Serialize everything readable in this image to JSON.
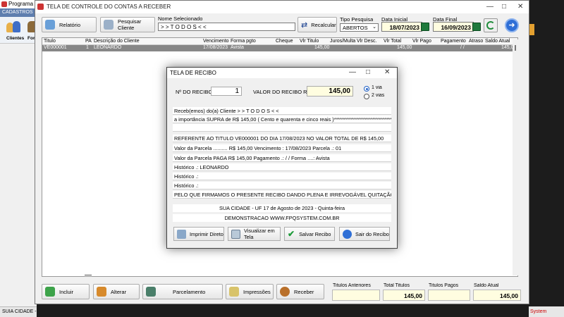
{
  "bg_app": {
    "title": "Programa",
    "subtitle": "CADASTROS",
    "tb_clientes": "Clientes",
    "tb_forn": "For",
    "status_city": "SUIA CIDADE -",
    "right_partial": "System"
  },
  "main": {
    "title": "TELA DE CONTROLE DO CONTAS A RECEBER",
    "btn_relatorio": "Relatório",
    "btn_pesquisar": "Pesquisar Cliente",
    "nome_label": "Nome Selecionado",
    "nome_value": "> > T O D O S < <",
    "btn_recalcular": "Recalcular",
    "tipo_label": "Tipo Pesquisa",
    "tipo_value": "ABERTOS",
    "data_inicial_label": "Data Inicial",
    "data_inicial_value": "18/07/2023",
    "data_final_label": "Data Final",
    "data_final_value": "16/09/2023",
    "columns": {
      "titulo": "Titulo",
      "pa": "PA",
      "descricao": "Descrição do Cliente",
      "vencimento": "Vencimento",
      "forma": "Forma pgto",
      "cheque": "Cheque",
      "vlr_titulo": "Vlr Titulo",
      "juros": "Juros/Multa",
      "vlr_desc": "Vlr Desc.",
      "vlr_total": "Vlr Total",
      "vlr_pago": "Vlr Pago",
      "pagamento": "Pagamento",
      "atraso": "Atraso",
      "saldo": "Saldo Atual"
    },
    "row": {
      "titulo": "VE000001",
      "pa": "1",
      "descricao": "LEONARDO",
      "vencimento": "17/08/2023",
      "forma": "Avista",
      "vlr_titulo": "145,00",
      "vlr_total": "145,00",
      "pagamento": "/ /",
      "saldo": "145,00"
    },
    "btn_incluir": "Incluir",
    "btn_alterar": "Alterar",
    "btn_parcelamento": "Parcelamento",
    "btn_impressoes": "Impressões",
    "btn_receber": "Receber",
    "tot_anteriores_label": "Titulos Anteriores",
    "tot_total_label": "Total Titulos",
    "tot_total_value": "145,00",
    "tot_pagos_label": "Titulos Pagos",
    "tot_saldo_label": "Saldo Atual",
    "tot_saldo_value": "145,00"
  },
  "dialog": {
    "title": "TELA DE RECIBO",
    "num_label": "Nº DO RECIBO",
    "num_value": "1",
    "valor_label": "VALOR DO RECIBO R$",
    "valor_value": "145,00",
    "radio1": "1 via",
    "radio2": "2 vias",
    "l1": "Receb(emos) do(a) Cliente > > T O D O S < <",
    "l2": "a importância SUPRA de R$      145,00 ( Cento e quarenta e cinco reais )**************************************",
    "l3": "",
    "l4": "REFERENTE AO TITULO   VE000001    DO DIA 17/08/2023   NO VALOR TOTAL DE R$         145,00",
    "l5": "Valor da Parcela .......... R$         145,00   Vencimento :  17/08/2023    Parcela .:   01",
    "l6": "Valor da Parcela PAGA R$         145,00   Pagamento .:    /  /          Forma ....:   Avista",
    "l7": "Histórico .: LEONARDO",
    "l8": "Histórico .:",
    "l9": "Histórico .:",
    "l10": "PELO QUE FIRMAMOS O PRESENTE RECIBO DANDO PLENA E IRREVOGÁVEL QUITAÇÃO.",
    "city": "SUA CIDADE - UF 17 de Agosto de 2023 - Quinta-feira",
    "site": "DEMONSTRACAO WWW.FPQSYSTEM.COM.BR",
    "btn_imprimir": "Imprimir Direto",
    "btn_visualizar": "Visualizar em Tela",
    "btn_salvar": "Salvar Recibo",
    "btn_sair": "Sair do Recibo"
  },
  "colors": {
    "selected_row": "#878787",
    "yellow_field": "#fffde0",
    "blue_header": "#5e7eae"
  }
}
